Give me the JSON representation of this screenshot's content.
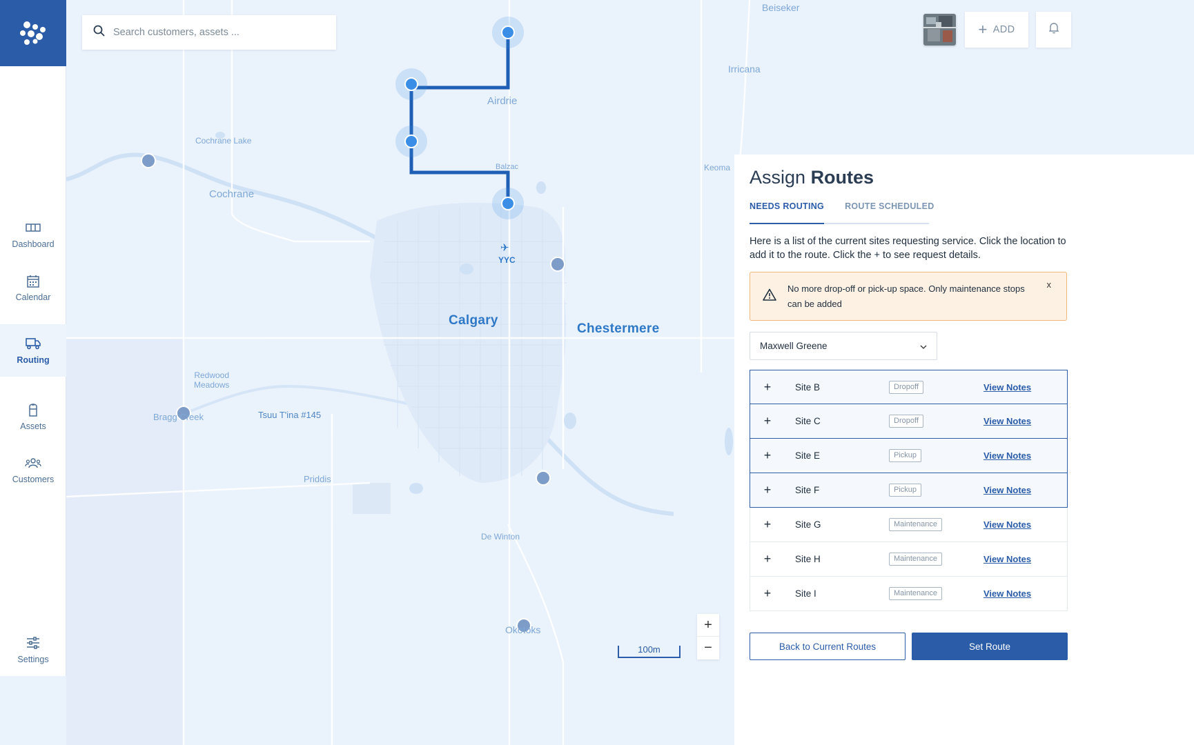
{
  "search": {
    "placeholder": "Search customers, assets ..."
  },
  "header": {
    "add_label": "ADD"
  },
  "sidebar": {
    "items": [
      {
        "label": "Dashboard",
        "icon": "dashboard-icon"
      },
      {
        "label": "Calendar",
        "icon": "calendar-icon"
      },
      {
        "label": "Routing",
        "icon": "truck-icon",
        "active": true
      },
      {
        "label": "Assets",
        "icon": "assets-icon"
      },
      {
        "label": "Customers",
        "icon": "customers-icon"
      },
      {
        "label": "Settings",
        "icon": "settings-icon"
      }
    ]
  },
  "map": {
    "labels": {
      "beiseker": "Beiseker",
      "irricana": "Irricana",
      "airdrie": "Airdrie",
      "cochrane_lake": "Cochrane Lake",
      "cochrane": "Cochrane",
      "balzac": "Balzac",
      "keoma": "Keoma",
      "yyc": "YYC",
      "calgary": "Calgary",
      "chestermere": "Chestermere",
      "redwood_meadows": "Redwood\nMeadows",
      "bragg_creek": "Bragg Creek",
      "tsuu_tina": "Tsuu T'ina #145",
      "priddis": "Priddis",
      "de_winton": "De Winton",
      "okotoks": "Okotoks"
    },
    "scale_label": "100m",
    "zoom_in": "+",
    "zoom_out": "−",
    "colors": {
      "route": "#1f5eb5",
      "active_pin": "#3a8ee6",
      "inactive_pin": "#7d9cc8",
      "water": "#cfe1f5"
    }
  },
  "panel": {
    "title_prefix": "Assign",
    "title_strong": "Routes",
    "tabs": [
      "NEEDS ROUTING",
      "ROUTE SCHEDULED"
    ],
    "description": "Here is a list of the current sites requesting service. Click the location to add it to the route. Click the + to see request details.",
    "alert": {
      "text": "No more drop-off or pick-up space. Only maintenance stops can be added",
      "close": "x"
    },
    "select": {
      "value": "Maxwell Greene"
    },
    "sites": [
      {
        "name": "Site B",
        "type": "Dropoff",
        "link": "View Notes",
        "selected": true
      },
      {
        "name": "Site C",
        "type": "Dropoff",
        "link": "View Notes",
        "selected": true
      },
      {
        "name": "Site E",
        "type": "Pickup",
        "link": "View Notes",
        "selected": true
      },
      {
        "name": "Site F",
        "type": "Pickup",
        "link": "View Notes",
        "selected": true
      },
      {
        "name": "Site G",
        "type": "Maintenance",
        "link": "View Notes",
        "selected": false
      },
      {
        "name": "Site H",
        "type": "Maintenance",
        "link": "View Notes",
        "selected": false
      },
      {
        "name": "Site I",
        "type": "Maintenance",
        "link": "View Notes",
        "selected": false
      }
    ],
    "back_button": "Back to Current Routes",
    "set_button": "Set Route"
  }
}
